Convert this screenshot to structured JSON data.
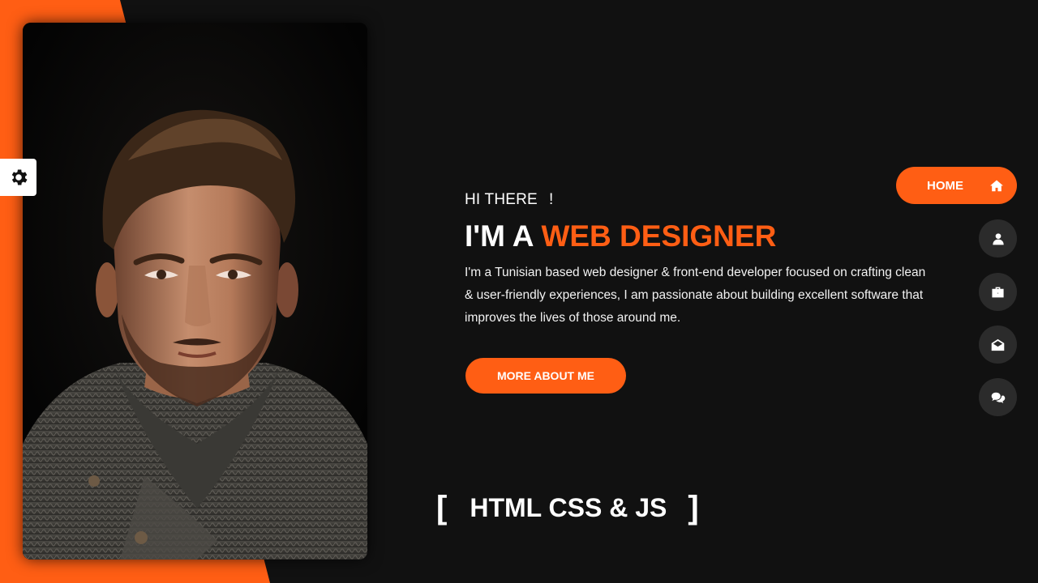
{
  "colors": {
    "accent": "#ff5e14",
    "background": "#111111",
    "nav_button": "#2b2b2b"
  },
  "settings": {
    "icon": "gear-icon"
  },
  "hero": {
    "greeting_prefix": "HI THERE",
    "greeting_suffix": "!",
    "headline_prefix": "I'M A",
    "headline_accent": "WEB DESIGNER",
    "bio": "I'm a Tunisian based web designer & front-end developer focused on crafting clean & user-friendly experiences, I am passionate about building excellent software that improves the lives of those around me.",
    "cta_label": "MORE ABOUT ME"
  },
  "skills": {
    "open_bracket": "[",
    "text": "HTML CSS & JS",
    "close_bracket": "]"
  },
  "nav": {
    "home_label": "HOME",
    "items": [
      {
        "icon": "home-icon"
      },
      {
        "icon": "user-icon"
      },
      {
        "icon": "briefcase-icon"
      },
      {
        "icon": "envelope-open-icon"
      },
      {
        "icon": "comments-icon"
      }
    ]
  }
}
